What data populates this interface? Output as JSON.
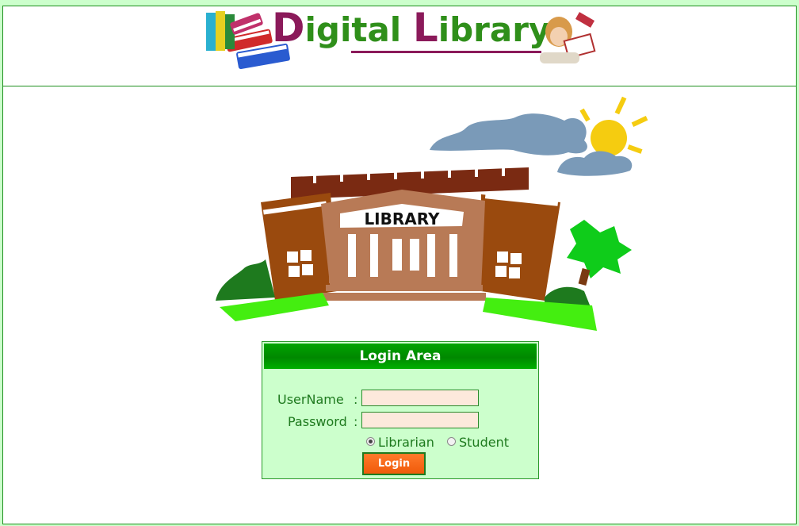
{
  "banner": {
    "title_first_letter": "D",
    "title_rest_1": "igital ",
    "title_second_letter": "L",
    "title_rest_2": "ibrary"
  },
  "illustration": {
    "sign_text": "LIBRARY"
  },
  "login": {
    "header": "Login Area",
    "username_label": "UserName",
    "username_colon": ":",
    "password_label": "Password",
    "password_colon": ":",
    "username_value": "",
    "password_value": "",
    "role_options": [
      {
        "label": "Librarian",
        "selected": true
      },
      {
        "label": "Student",
        "selected": false
      }
    ],
    "submit_label": "Login"
  },
  "colors": {
    "page_bg": "#ccffcc",
    "border": "#1e8f1e",
    "header_green": "#009900",
    "label_green": "#1e7a1e",
    "input_bg": "#fde9dc",
    "button_orange": "#f86a1a",
    "title_green": "#2f8f1a",
    "title_purple": "#8b1a5a"
  }
}
